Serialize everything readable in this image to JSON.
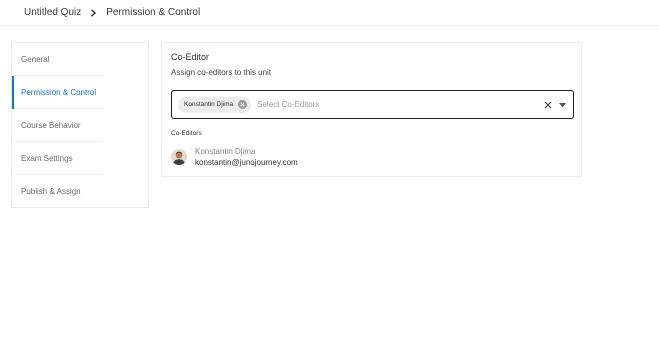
{
  "breadcrumb": {
    "root": "Untitled Quiz",
    "current": "Permission & Control"
  },
  "sidebar": {
    "items": [
      {
        "label": "General"
      },
      {
        "label": "Permission & Control"
      },
      {
        "label": "Course Behavior"
      },
      {
        "label": "Exam Settings"
      },
      {
        "label": "Publish & Assign"
      }
    ],
    "active_index": 1
  },
  "coeditor": {
    "title": "Co-Editor",
    "subtitle": "Assign co-editors to this unit",
    "select": {
      "chip_label": "Konstantin Djima",
      "placeholder": "Select Co-Editors"
    },
    "list_label": "Co-Editors",
    "editors": [
      {
        "name": "Konstantin Djima",
        "email": "konstantin@junojourney.com"
      }
    ]
  },
  "colors": {
    "accent": "#1a73c8",
    "border": "#ececec",
    "text": "#333333"
  },
  "icons": {
    "breadcrumb_separator": "chevron-right-icon",
    "chip_remove": "close-circle-icon",
    "clear": "close-icon",
    "dropdown": "caret-down-icon"
  }
}
